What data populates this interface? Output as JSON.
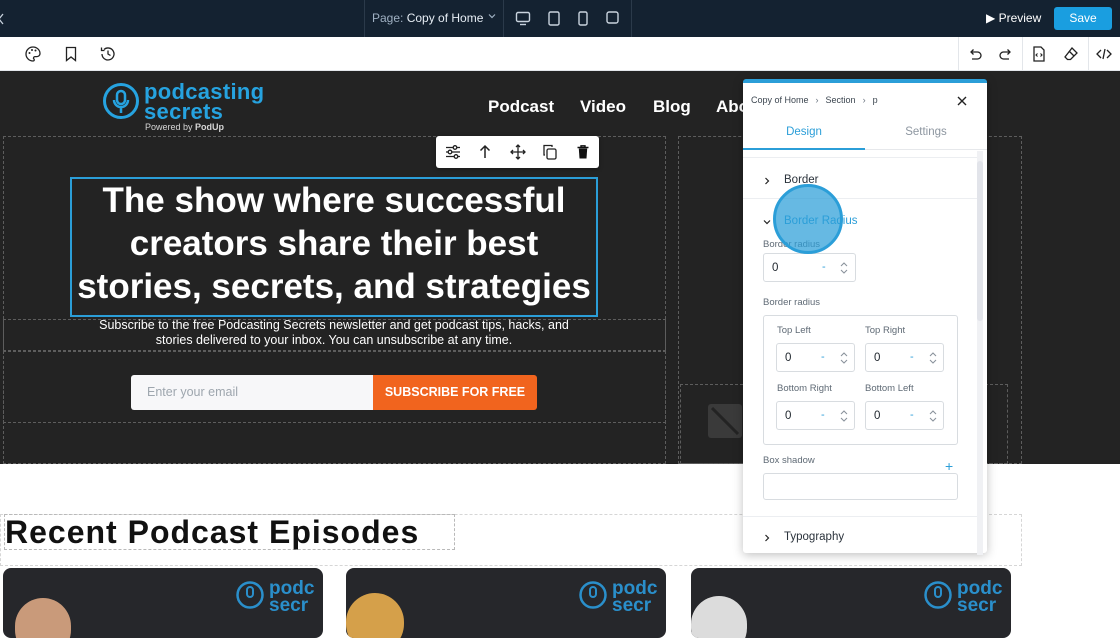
{
  "topbar": {
    "page_label": "Page:",
    "page_name": "Copy of Home",
    "preview_label": "Preview",
    "save_label": "Save",
    "accent_color": "#1a9ee0",
    "bg_color": "#142231"
  },
  "toolbar": {
    "left_icons": [
      "palette-icon",
      "bookmark-icon",
      "history-icon"
    ],
    "right_icons": [
      "undo-icon",
      "redo-icon",
      "code-file-icon",
      "eraser-icon",
      "code-icon"
    ]
  },
  "site": {
    "logo_line1": "podcasting",
    "logo_line2": "secrets",
    "logo_powered": "Powered by",
    "logo_powered_brand": "PodUp",
    "nav": [
      "Podcast",
      "Video",
      "Blog",
      "Abo"
    ],
    "hero_title": "The show where successful creators share their best stories, secrets, and strategies",
    "hero_subtitle": "Subscribe to the free Podcasting Secrets newsletter and get podcast tips, hacks, and stories delivered to your inbox. You can unsubscribe at any time.",
    "email_placeholder": "Enter your email",
    "subscribe_label": "SUBSCRIBE FOR FREE",
    "episodes_title": "Recent Podcast Episodes",
    "card_logo_line1": "podc",
    "card_logo_line2": "secr",
    "cta_color": "#f1641e"
  },
  "panel": {
    "breadcrumb": [
      "Copy of Home",
      "Section",
      "p"
    ],
    "tabs": {
      "design": "Design",
      "settings": "Settings"
    },
    "sections": {
      "border": "Border",
      "border_radius": "Border Radius",
      "typography": "Typography"
    },
    "border_radius_label": "Border radius",
    "border_radius_value": "0",
    "border_radius_corners_label": "Border radius",
    "corners": {
      "top_left_label": "Top Left",
      "top_left_value": "0",
      "top_right_label": "Top Right",
      "top_right_value": "0",
      "bottom_right_label": "Bottom Right",
      "bottom_right_value": "0",
      "bottom_left_label": "Bottom Left",
      "bottom_left_value": "0"
    },
    "unit_placeholder": "-",
    "box_shadow_label": "Box shadow",
    "plus": "+"
  }
}
